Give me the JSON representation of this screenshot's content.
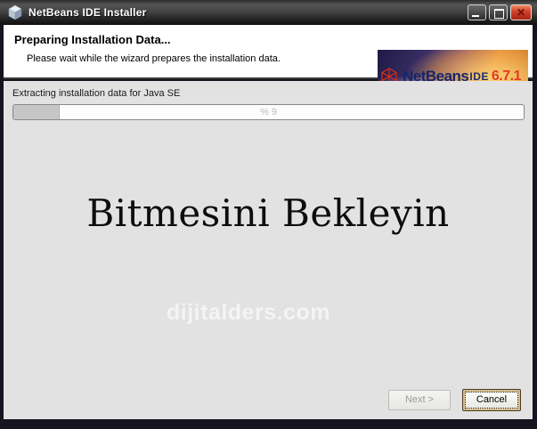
{
  "window": {
    "title": "NetBeans IDE Installer"
  },
  "header": {
    "title": "Preparing Installation Data...",
    "subtitle": "Please wait while the wizard prepares the installation data."
  },
  "brand": {
    "name": "NetBeans",
    "suffix": "IDE",
    "version": "6.7.1"
  },
  "progress": {
    "label": "Extracting installation data for Java SE",
    "percent": 9,
    "percent_text": "% 9"
  },
  "message": {
    "text": "Bitmesini Bekleyin"
  },
  "watermark": {
    "text": "dijitalders.com"
  },
  "buttons": {
    "next": "Next >",
    "cancel": "Cancel"
  },
  "colors": {
    "titlebar_dark": "#1a1a1a",
    "client_gray": "#e2e2e2",
    "banner_orange": "#e0913f",
    "banner_purple": "#1e1a46",
    "brand_navy": "#14266b",
    "brand_red": "#e33a24",
    "close_red": "#c33a22",
    "progress_fill": "#c6c6c6"
  }
}
